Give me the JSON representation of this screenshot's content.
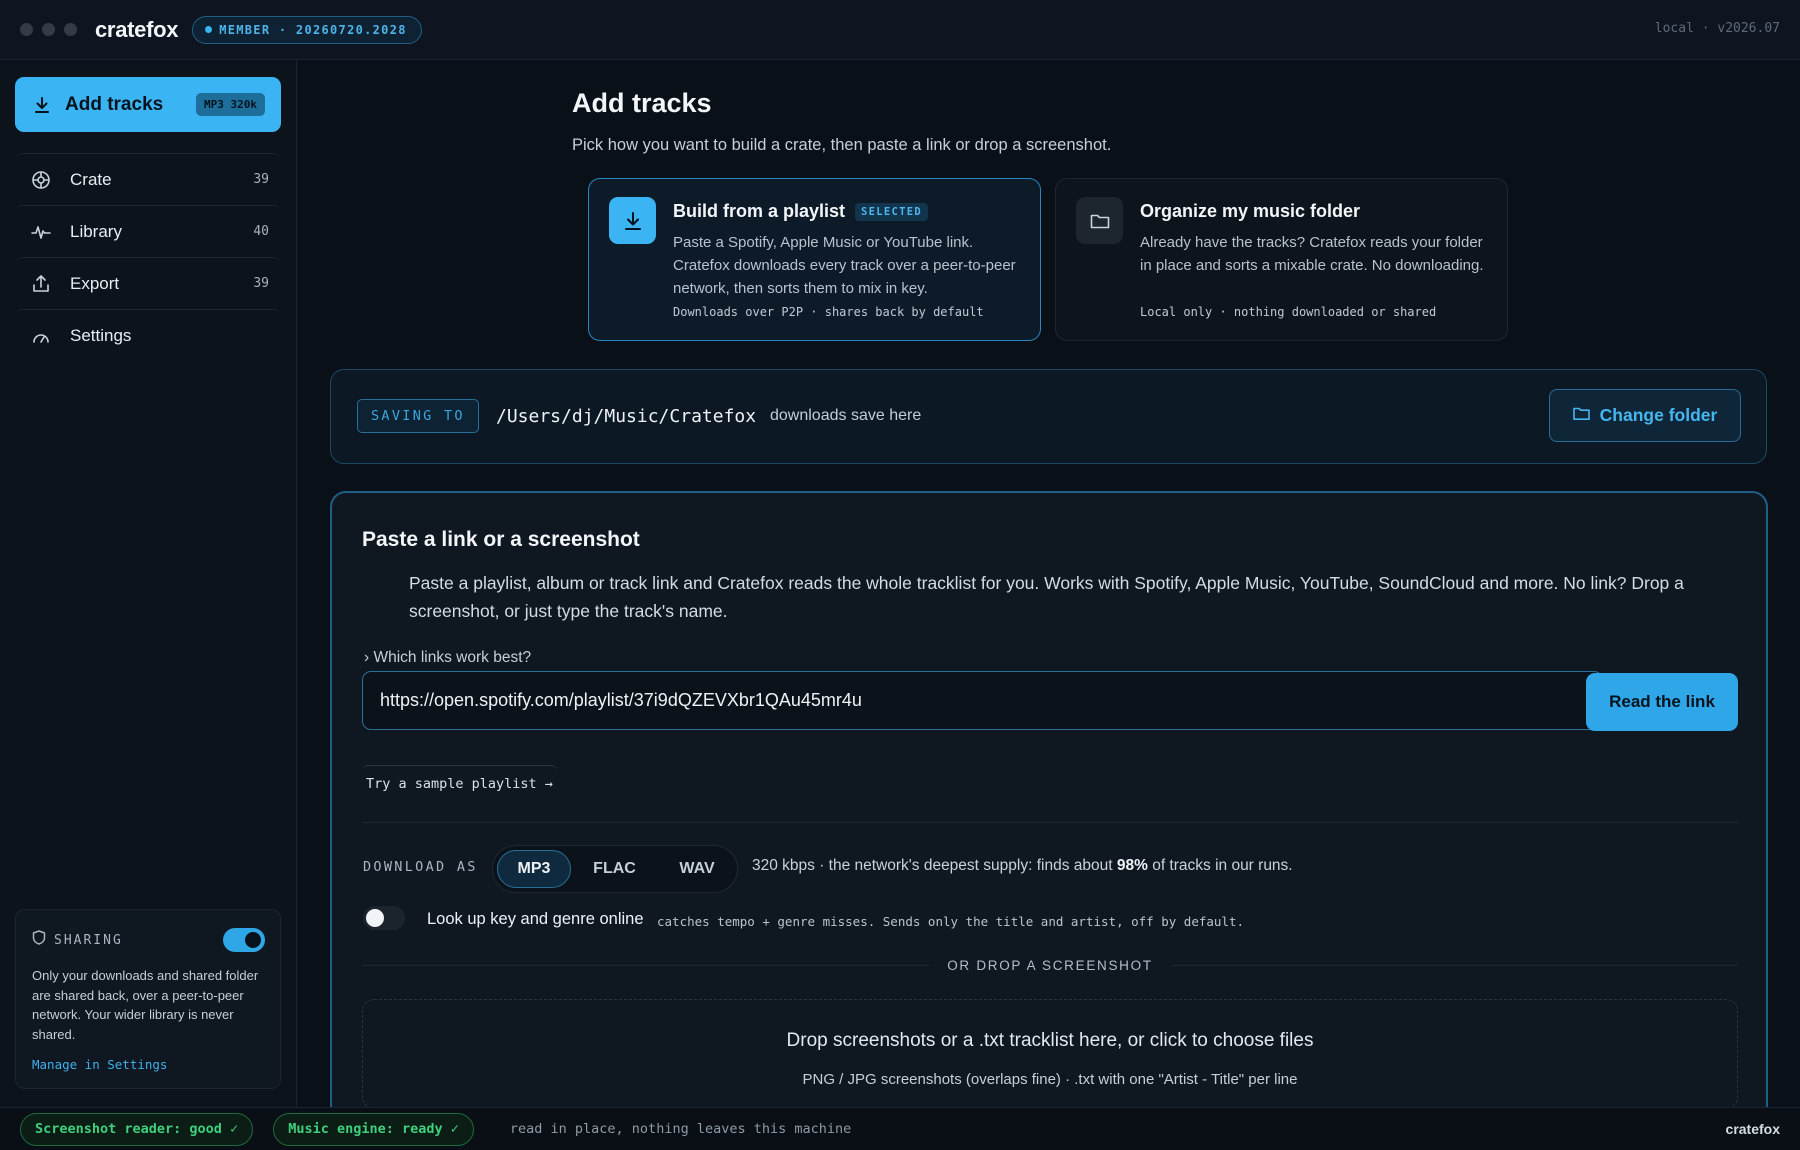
{
  "titlebar": {
    "brand": "cratefox",
    "member_badge": "MEMBER · 20260720.2028",
    "version": "local · v2026.07"
  },
  "sidebar": {
    "add_tracks": {
      "label": "Add tracks",
      "quality": "MP3 320k"
    },
    "items": [
      {
        "label": "Crate",
        "count": "39",
        "icon": "crate-icon"
      },
      {
        "label": "Library",
        "count": "40",
        "icon": "pulse-icon"
      },
      {
        "label": "Export",
        "count": "39",
        "icon": "upload-icon"
      },
      {
        "label": "Settings",
        "count": "",
        "icon": "gauge-icon"
      }
    ],
    "sharing": {
      "label": "SHARING",
      "enabled": true,
      "text": "Only your downloads and shared folder are shared back, over a peer-to-peer network. Your wider library is never shared.",
      "link": "Manage in Settings"
    }
  },
  "main": {
    "title": "Add tracks",
    "subtitle": "Pick how you want to build a crate, then paste a link or drop a screenshot.",
    "modes": [
      {
        "title": "Build from a playlist",
        "badge": "SELECTED",
        "description": "Paste a Spotify, Apple Music or YouTube link. Cratefox downloads every track over a peer-to-peer network, then sorts them to mix in key.",
        "footer": "Downloads over P2P · shares back by default"
      },
      {
        "title": "Organize my music folder",
        "description": "Already have the tracks? Cratefox reads your folder in place and sorts a mixable crate. No downloading.",
        "footer": "Local only · nothing downloaded or shared"
      }
    ],
    "saving": {
      "label": "SAVING TO",
      "path": "/Users/dj/Music/Cratefox",
      "hint": "downloads save here",
      "change_button": "Change folder"
    },
    "paste": {
      "title": "Paste a link or a screenshot",
      "intro": "Paste a playlist, album or track link and Cratefox reads the whole tracklist for you. Works with Spotify, Apple Music, YouTube, SoundCloud and more. No link? Drop a screenshot, or just type the track's name.",
      "which_links": "Which links work best?",
      "url_value": "https://open.spotify.com/playlist/37i9dQZEVXbr1QAu45mr4u",
      "read_button": "Read the link",
      "sample_link": "Try a sample playlist →",
      "download_as_label": "DOWNLOAD AS",
      "formats": [
        "MP3",
        "FLAC",
        "WAV"
      ],
      "selected_format": "MP3",
      "format_note_pre": "320 kbps · the network's deepest supply: finds about ",
      "format_note_pct": "98%",
      "format_note_post": " of tracks in our runs.",
      "lookup_label": "Look up key and genre online",
      "lookup_enabled": false,
      "lookup_hint": "catches tempo + genre misses. Sends only the title and artist, off by default.",
      "or_drop": "OR DROP A SCREENSHOT",
      "drop_title": "Drop screenshots or a .txt tracklist here, or click to choose files",
      "drop_sub": "PNG / JPG screenshots (overlaps fine) · .txt with one \"Artist - Title\" per line"
    }
  },
  "statusbar": {
    "chip1": "Screenshot reader: good ✓",
    "chip2": "Music engine: ready ✓",
    "note": "read in place, nothing leaves this machine",
    "brand": "cratefox"
  },
  "colors": {
    "accent": "#3ab4f2",
    "background": "#0a1018",
    "status_ok": "#3fd07d"
  }
}
